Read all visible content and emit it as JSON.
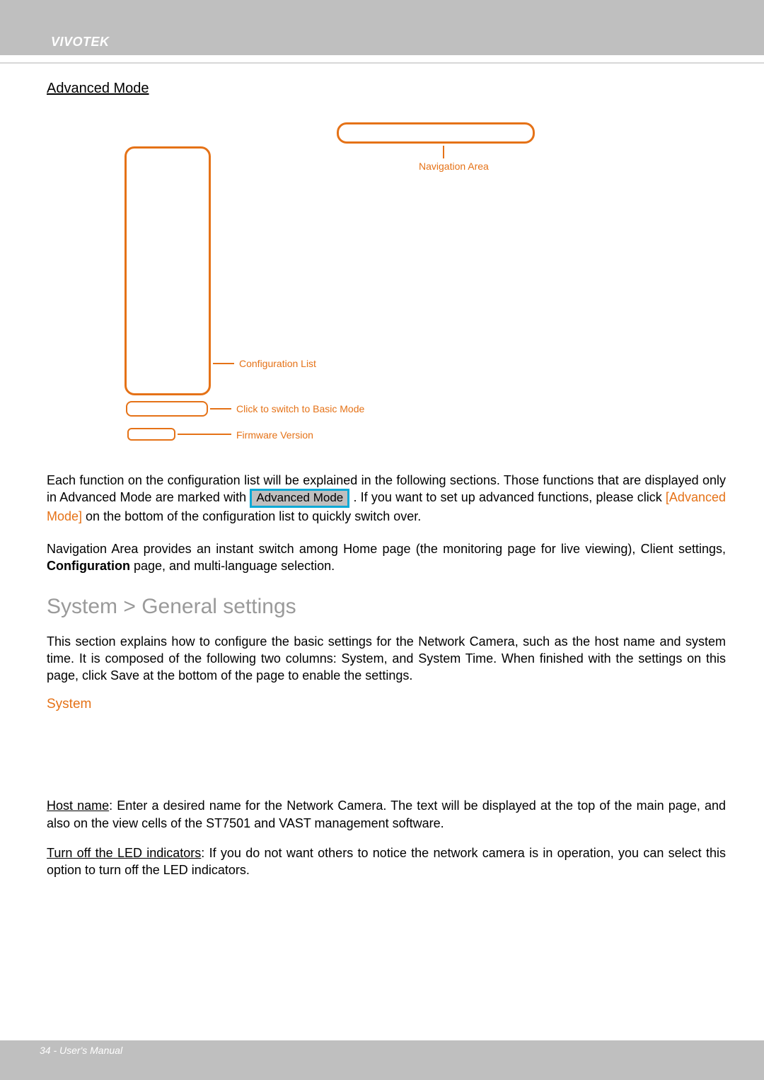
{
  "brand": "VIVOTEK",
  "section_title": "Advanced Mode",
  "diagram": {
    "nav_label": "Navigation Area",
    "config_label": "Configuration List",
    "switch_label": "Click to switch to Basic Mode",
    "fw_label": "Firmware Version"
  },
  "para1_a": "Each function on the configuration list will be explained in the following sections. Those functions that are displayed only in Advanced Mode are marked with ",
  "badge": "Advanced Mode",
  "para1_b": ". If you want to set up advanced functions, please click ",
  "link": "[Advanced Mode]",
  "para1_c": " on the bottom of the configuration list to quickly switch over.",
  "para2_a": "Navigation Area provides an instant switch among Home page (the monitoring page for live viewing), ",
  "para2_b": "Client settings",
  "para2_c": ", ",
  "para2_d": "Configuration",
  "para2_e": " page, and multi-language selection.",
  "h2": "System > General settings",
  "para3": "This section explains how to configure the basic settings for the Network Camera, such as the host name and system time. It is composed of the following two columns: System, and System Time. When finished with the settings on this page, click Save at the bottom of the page to enable the settings.",
  "h3": "System",
  "host_label": "Host name",
  "host_text": ": Enter a desired name for the Network Camera. The text will be displayed at the top of the main page, and also on the view cells of the ST7501 and VAST management software.",
  "led_label": "Turn off the LED indicators",
  "led_text": ": If you do not want others to notice the network camera is in operation, you can select this option to turn off the LED indicators.",
  "footer": "34 - User's Manual"
}
